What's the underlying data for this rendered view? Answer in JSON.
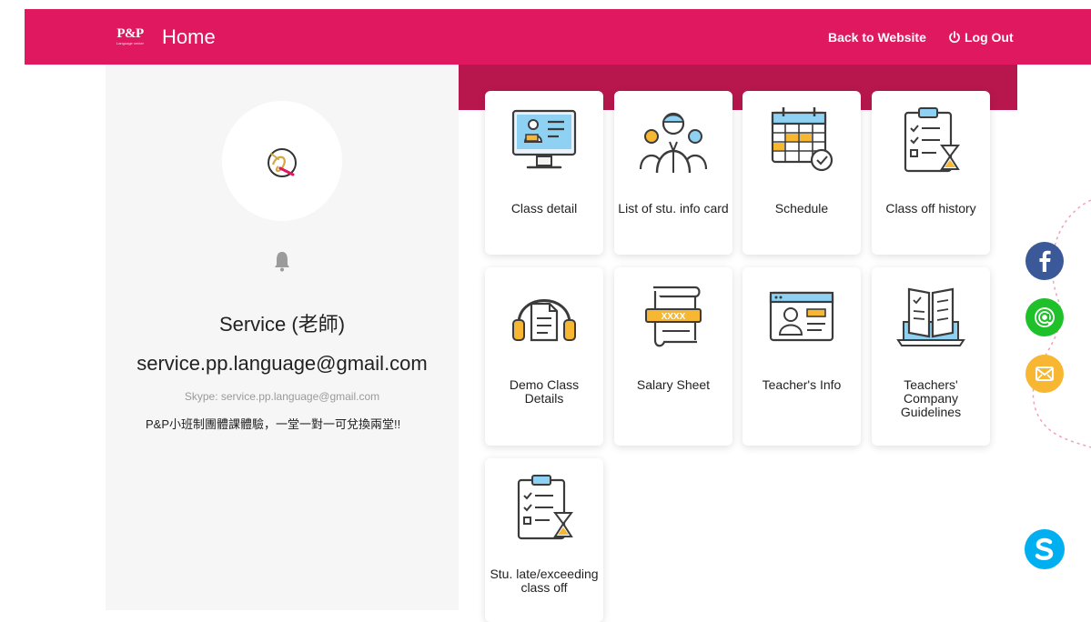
{
  "header": {
    "logo_text": "P&P",
    "logo_sub": "Language center",
    "title": "Home",
    "back_link": "Back to Website",
    "logout": "Log Out"
  },
  "profile": {
    "name": "Service (老師)",
    "email": "service.pp.language@gmail.com",
    "skype": "Skype: service.pp.language@gmail.com",
    "note": "P&P小班制團體課體驗，一堂一對一可兌換兩堂!!"
  },
  "menu": [
    {
      "label": "Class detail",
      "icon": "class-detail-icon"
    },
    {
      "label": "List of stu. info card",
      "icon": "students-group-icon"
    },
    {
      "label": "Schedule",
      "icon": "calendar-clock-icon"
    },
    {
      "label": "Class off history",
      "icon": "checklist-hourglass-icon"
    },
    {
      "label": "Demo Class Details",
      "icon": "headset-document-icon"
    },
    {
      "label": "Salary Sheet",
      "icon": "scroll-icon"
    },
    {
      "label": "Teacher's Info",
      "icon": "profile-card-icon"
    },
    {
      "label": "Teachers' Company Guidelines",
      "icon": "laptop-book-icon"
    },
    {
      "label": "Stu. late/exceeding class off",
      "icon": "checklist-hourglass-icon"
    }
  ],
  "social": [
    "facebook-icon",
    "at-sign-icon",
    "mail-icon",
    "skype-icon"
  ],
  "colors": {
    "header": "#e0185f",
    "band": "#b8174d",
    "facebook": "#3b5998",
    "at": "#1fc12b",
    "mail": "#f7b733",
    "skype": "#00aff0"
  }
}
